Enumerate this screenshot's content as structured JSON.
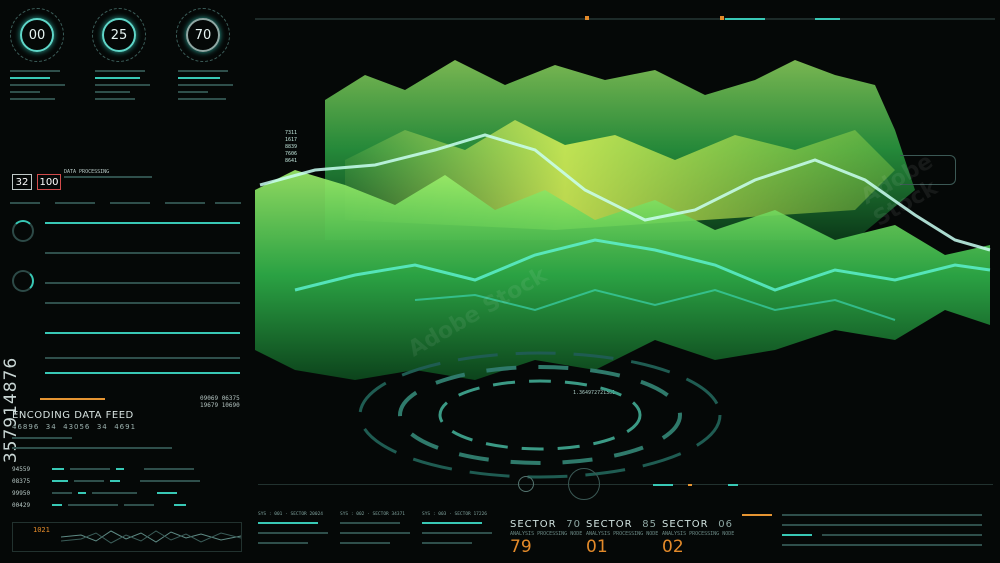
{
  "gauges": [
    {
      "value": "00"
    },
    {
      "value": "25"
    },
    {
      "value": "70"
    }
  ],
  "small_boxes": [
    {
      "value": "32"
    },
    {
      "value": "100"
    }
  ],
  "data_processing_label": "DATA PROCESSING",
  "feed": {
    "title": "ENCODING DATA FEED",
    "numbers": [
      "46896",
      "34",
      "43056",
      "34",
      "4691"
    ],
    "right_values": [
      "09069",
      "06375",
      "19679",
      "10690"
    ]
  },
  "row_codes": [
    "94559",
    "08375",
    "99950",
    "00429"
  ],
  "side_code": "357914876",
  "bottom_left_code": "1021",
  "readouts": [
    "7311",
    "1617",
    "8839",
    "7606",
    "8641"
  ],
  "coord_label": "1.364972721301",
  "sectors": [
    {
      "label": "SECTOR",
      "num": "70",
      "sub": "ANALYSIS PROCESSING NODE",
      "value": "79"
    },
    {
      "label": "SECTOR",
      "num": "85",
      "sub": "ANALYSIS PROCESSING NODE",
      "value": "01"
    },
    {
      "label": "SECTOR",
      "num": "06",
      "sub": "ANALYSIS PROCESSING NODE",
      "value": "02"
    }
  ],
  "bottom_labels": [
    "SYS : 001 · SECTOR 20024",
    "SYS : 002 · SECTOR 34371",
    "SYS : 003 · SECTOR 17226"
  ],
  "watermark": "Adobe Stock",
  "colors": {
    "accent": "#38c8b5",
    "orange": "#e38a2a",
    "bg": "#050807",
    "terrain": "#3fd15a"
  }
}
